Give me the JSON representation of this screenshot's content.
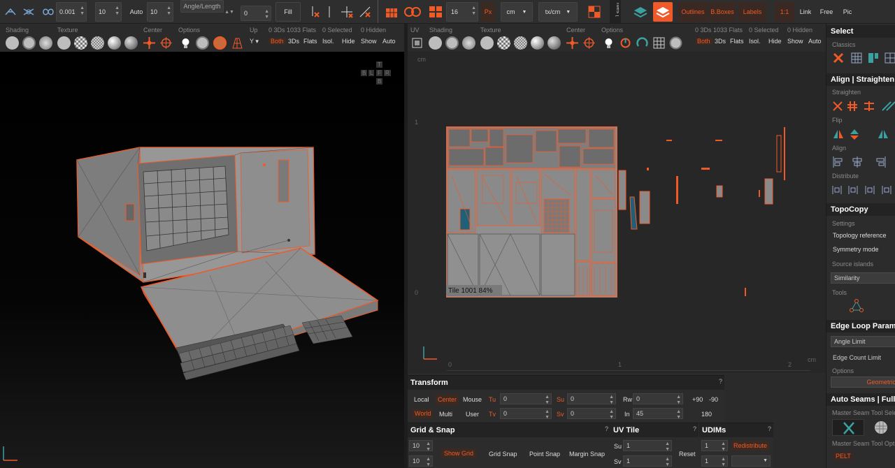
{
  "top_toolbar": {
    "value_0001": "0.001",
    "grid_a": "10",
    "auto_label": "Auto",
    "grid_b": "10",
    "angle_length": "Angle/Length",
    "zero_value": "0",
    "fill_label": "Fill",
    "size_value": "16",
    "px_label": "Px",
    "cm_label": "cm",
    "tx_cm_label": "tx/cm",
    "outlines_label": "Outlines",
    "bboxes_label": "B.Boxes",
    "labels_label": "Labels",
    "ratio_label": "1:1",
    "link_label": "Link",
    "free_label": "Free",
    "pic_label": "Pic"
  },
  "left_viewport_bar": {
    "shading": "Shading",
    "texture": "Texture",
    "center": "Center",
    "options": "Options",
    "up": "Up",
    "up_value": "Y",
    "stats": "0 3Ds 1033 Flats",
    "selected": "0 Selected",
    "hidden": "0 Hidden",
    "both": "Both",
    "threeds": "3Ds",
    "flats": "Flats",
    "isol": "Isol.",
    "hide": "Hide",
    "show": "Show",
    "auto": "Auto"
  },
  "view_cube": {
    "top": "T",
    "bottom": "B",
    "left": "B",
    "front": "L",
    "f": "F",
    "r": "R"
  },
  "right_viewport_bar": {
    "uv": "UV",
    "shading": "Shading",
    "texture": "Texture",
    "center": "Center",
    "options": "Options",
    "stats": "0 3Ds 1033 Flats",
    "selected": "0 Selected",
    "hidden": "0 Hidden",
    "both": "Both",
    "threeds": "3Ds",
    "flats": "Flats",
    "isol": "Isol.",
    "hide": "Hide",
    "show": "Show",
    "auto": "Auto"
  },
  "uv_viewport": {
    "cm_top": "cm",
    "cm_bottom": "cm",
    "axis_1_v": "1",
    "axis_0_v": "0",
    "axis_0_u": "0",
    "axis_1_u": "1",
    "axis_2_u": "2",
    "tile_label": "Tile 1001 84%"
  },
  "transform": {
    "title": "Transform",
    "help": "?",
    "local": "Local",
    "center": "Center",
    "mouse": "Mouse",
    "tu_label": "Tu",
    "tu_value": "0",
    "su_label": "Su",
    "su_value": "0",
    "rw_label": "Rw",
    "rw_value": "0",
    "plus90": "+90",
    "minus90": "-90",
    "world": "World",
    "multi": "Multi",
    "user": "User",
    "tv_label": "Tv",
    "tv_value": "0",
    "sv_label": "Sv",
    "sv_value": "0",
    "in_label": "In",
    "in_value": "45",
    "deg180": "180"
  },
  "grid_snap": {
    "title": "Grid & Snap",
    "help": "?",
    "val_a": "10",
    "val_b": "10",
    "show_grid": "Show Grid",
    "grid_snap": "Grid Snap",
    "point_snap": "Point Snap",
    "margin_snap": "Margin Snap"
  },
  "uv_tile": {
    "title": "UV Tile",
    "help": "?",
    "su_label": "Su",
    "su_value": "1",
    "sv_label": "Sv",
    "sv_value": "1",
    "reset": "Reset"
  },
  "udims": {
    "title": "UDIMs",
    "help": "?",
    "val_a": "1",
    "val_b": "1",
    "redistribute": "Redistribute"
  },
  "right_panel": {
    "select_title": "Select",
    "classics": "Classics",
    "align_title": "Align | Straighten |",
    "straighten": "Straighten",
    "flip": "Flip",
    "align": "Align",
    "distribute": "Distribute",
    "topocopy_title": "TopoCopy",
    "settings": "Settings",
    "topology_reference": "Topology reference",
    "symmetry_mode": "Symmetry mode",
    "source_islands": "Source islands",
    "similarity": "Similarity",
    "tools": "Tools",
    "edge_loop_title": "Edge Loop Parame",
    "angle_limit": "Angle Limit",
    "edge_count_limit": "Edge Count Limit",
    "options": "Options",
    "geometric": "Geometric",
    "auto_seams_title": "Auto Seams | Full A",
    "master_seam_tool_sele": "Master Seam Tool Sele",
    "master_seam_tool_opti": "Master Seam Tool Opti",
    "pelt": "PELT"
  },
  "colors": {
    "accent": "#f05a28",
    "panel": "#2c2c2c",
    "field": "#383838",
    "mesh_gray": "#8f8f8f"
  }
}
